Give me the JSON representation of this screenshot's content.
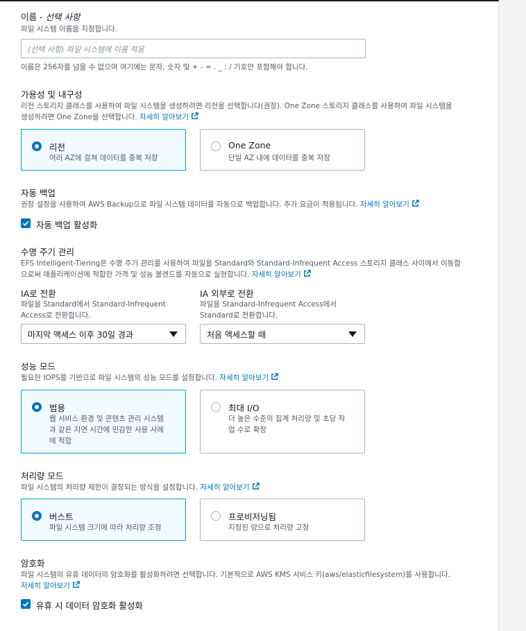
{
  "name": {
    "heading": "이름",
    "heading_optional": "선택 사항",
    "description": "파일 시스템 이름을 지정합니다.",
    "placeholder": "(선택 사항) 파일 시스템에 이름 적용",
    "constraint": "이름은 256자를 넘을 수 없으며 여기에는 문자, 숫자 및 + - = . _ : / 기호만 포함해야 합니다."
  },
  "availability": {
    "heading": "가용성 및 내구성",
    "description_1": "리전 스토리지 클래스를 사용하여 파일 시스템을 생성하려면 리전을 선택합니다(권장). One Zone 스토리지 클래스를 사용하여 파일 시스템을",
    "description_2": "생성하려면 One Zone을 선택합니다.",
    "link": "자세히 알아보기",
    "options": [
      {
        "title": "리전",
        "subtitle": "여러 AZ에 걸쳐 데이터를 중복 저장",
        "selected": true
      },
      {
        "title": "One Zone",
        "subtitle": "단일 AZ 내에 데이터를 중복 저장",
        "selected": false
      }
    ]
  },
  "backup": {
    "heading": "자동 백업",
    "description": "권장 설정을 사용하여 AWS Backup으로 파일 시스템 데이터를 자동으로 백업합니다. 추가 요금이 적용됩니다.",
    "link": "자세히 알아보기",
    "checkbox_label": "자동 백업 활성화",
    "checked": true
  },
  "lifecycle": {
    "heading": "수명 주기 관리",
    "description_1": "EFS Intelligent-Tiering은 수명 주기 관리를 사용하여 파일을 Standard와 Standard-Infrequent Access 스토리지 클래스 사이에서 이동함",
    "description_2": "으로써 애플리케이션에 적합한 가격 및 성능 블렌드를 자동으로 실현합니다.",
    "link": "자세히 알아보기",
    "to_ia": {
      "label": "IA로 전환",
      "description_1": "파일을 Standard에서 Standard-Infrequent",
      "description_2": "Access로 전환합니다.",
      "value": "마지막 액세스 이후 30일 경과"
    },
    "out_of_ia": {
      "label": "IA 외부로 전환",
      "description_1": "파일을 Standard-Infrequent Access에서",
      "description_2": "Standard로 전환합니다.",
      "value": "처음 액세스할 때"
    }
  },
  "performance": {
    "heading": "성능 모드",
    "description": "필요한 IOPS를 기반으로 파일 시스템의 성능 모드를 설정합니다.",
    "link": "자세히 알아보기",
    "options": [
      {
        "title": "범용",
        "line1": "웹 서비스 환경 및 콘텐츠 관리 시스템",
        "line2": "과 같은 지연 시간에 민감한 사용 사례",
        "line3": "에 적합",
        "selected": true
      },
      {
        "title": "최대 I/O",
        "line1": "더 높은 수준의 집계 처리량 및 초당 작",
        "line2": "업 수로 확장",
        "line3": "",
        "selected": false
      }
    ]
  },
  "throughput": {
    "heading": "처리량 모드",
    "description": "파일 시스템의 처리량 제한이 결정되는 방식을 설정합니다.",
    "link": "자세히 알아보기",
    "options": [
      {
        "title": "버스트",
        "subtitle": "파일 시스템 크기에 따라 처리량 조정",
        "selected": true
      },
      {
        "title": "프로비저닝됨",
        "subtitle": "지정된 양으로 처리량 고정",
        "selected": false
      }
    ]
  },
  "encryption": {
    "heading": "암호화",
    "description": "파일 시스템의 유휴 데이터의 암호화를 활성화하려면 선택합니다. 기본적으로 AWS KMS 서비스 키(aws/elasticfilesystem)를 사용합니다.",
    "link": "자세히 알아보기",
    "checkbox_label": "유휴 시 데이터 암호화 활성화",
    "checked": true
  },
  "colors": {
    "accent": "#0073bb",
    "selected_bg": "#f1faff",
    "selected_border": "#00a1c9"
  }
}
